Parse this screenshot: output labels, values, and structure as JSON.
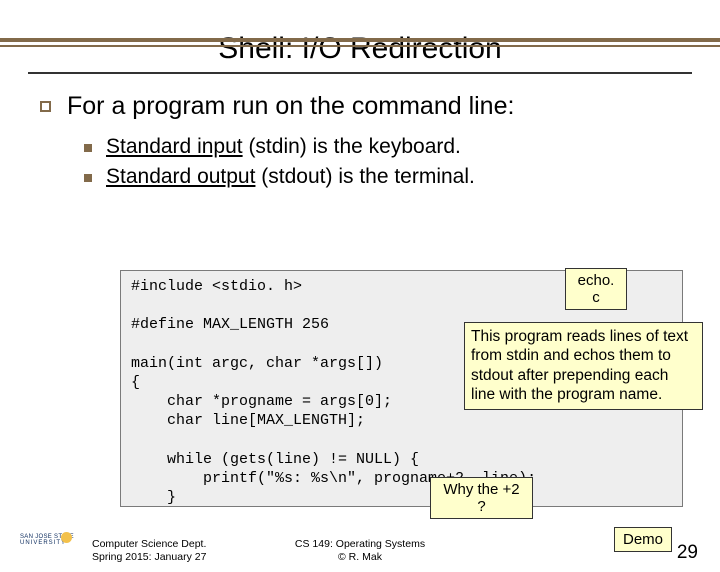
{
  "title": "Shell: I/O Redirection",
  "lvl1_text": "For a program run on the command line:",
  "lvl2": {
    "a_pre": "Standard input",
    "a_post": " (stdin) is the keyboard.",
    "b_pre": "Standard output",
    "b_post": " (stdout) is the terminal."
  },
  "code": "#include <stdio. h>\n\n#define MAX_LENGTH 256\n\nmain(int argc, char *args[])\n{\n    char *progname = args[0];\n    char line[MAX_LENGTH];\n\n    while (gets(line) != NULL) {\n        printf(\"%s: %s\\n\", progname+2, line);\n    }\n}",
  "callouts": {
    "echo": "echo. c",
    "desc": "This program reads lines of text from stdin and echos them to stdout after prepending each line with the program name.",
    "why": "Why the +2 ?",
    "demo": "Demo"
  },
  "footer": {
    "left1": "Computer Science Dept.",
    "left2": "Spring 2015: January 27",
    "center1": "CS 149: Operating Systems",
    "center2": "© R. Mak",
    "page": "29",
    "logo1": "SAN JOSE STATE",
    "logo2": "UNIVERSITY"
  }
}
